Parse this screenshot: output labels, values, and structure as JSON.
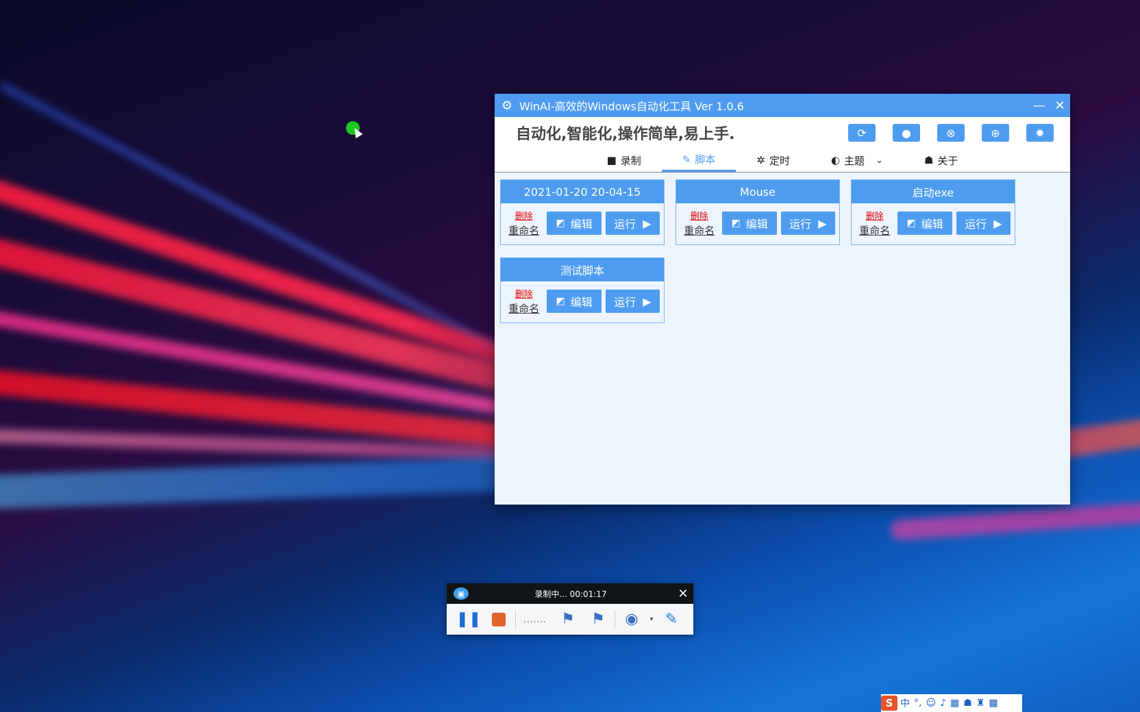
{
  "window": {
    "title": "WinAI-高效的Windows自动化工具 Ver 1.0.6",
    "minimize_icon": "minimize-icon",
    "close_icon": "close-icon"
  },
  "header": {
    "slogan": "自动化,智能化,操作简单,易上手.",
    "tools": [
      {
        "name": "refresh-icon",
        "glyph": "⟳"
      },
      {
        "name": "user-icon",
        "glyph": "●"
      },
      {
        "name": "stop-icon",
        "glyph": "⊗"
      },
      {
        "name": "globe-icon",
        "glyph": "⊕"
      },
      {
        "name": "gear-icon",
        "glyph": "✹"
      }
    ]
  },
  "tabs": [
    {
      "label": "录制",
      "icon": "video-icon",
      "glyph": "■"
    },
    {
      "label": "脚本",
      "icon": "pencil-icon",
      "glyph": "✎",
      "active": true
    },
    {
      "label": "定时",
      "icon": "cogs-icon",
      "glyph": "✲"
    },
    {
      "label": "主题",
      "icon": "contrast-icon",
      "glyph": "◐",
      "dropdown": true
    },
    {
      "label": "关于",
      "icon": "person-icon",
      "glyph": "☗"
    }
  ],
  "scripts": [
    {
      "name": "2021-01-20 20-04-15"
    },
    {
      "name": "Mouse"
    },
    {
      "name": "启动exe"
    },
    {
      "name": "测试脚本"
    }
  ],
  "card_labels": {
    "delete": "删除",
    "rename": "重命名",
    "edit": "编辑",
    "run": "运行"
  },
  "recorder": {
    "status": "录制中... 00:01:17",
    "dots": "......."
  },
  "tray": {
    "ime_logo": "S",
    "ime_mode": "中",
    "punct": "°,"
  },
  "colors": {
    "accent": "#4e9cf0",
    "content_bg": "#eef4fd",
    "delete_link": "#dd0000",
    "stop_button": "#e2632c"
  }
}
